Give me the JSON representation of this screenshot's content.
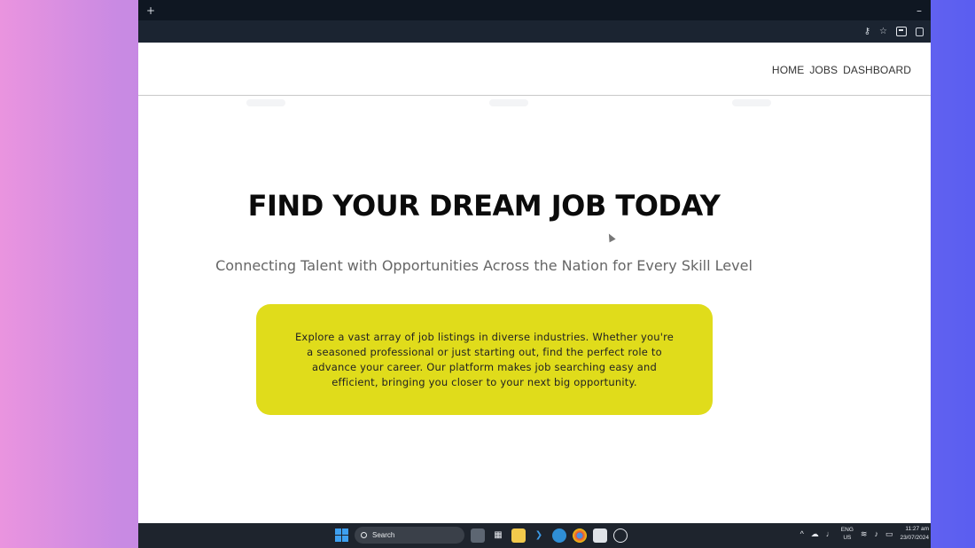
{
  "browser": {
    "new_tab_glyph": "+",
    "minimize_glyph": "–",
    "toolbar_icons": [
      "key-icon",
      "star-icon",
      "extension-icon",
      "puzzle-icon"
    ]
  },
  "nav": {
    "links": [
      "HOME",
      "JOBS",
      "DASHBOARD"
    ]
  },
  "hero": {
    "title": "FIND YOUR DREAM JOB TODAY",
    "subtitle": "Connecting Talent with Opportunities Across the Nation for Every Skill Level",
    "card_text": "Explore a vast array of job listings in diverse industries. Whether you're a seasoned professional or just starting out, find the perfect role to advance your career. Our platform makes job searching easy and efficient, bringing you closer to your next big opportunity.",
    "card_color": "#e0dc1b"
  },
  "taskbar": {
    "search_label": "Search",
    "language_top": "ENG",
    "language_bottom": "US",
    "time": "11:27 am",
    "date": "23/07/2024"
  },
  "colors": {
    "accent": "#e0dc1b",
    "chrome_dark": "#0f1722",
    "taskbar": "#1e242d"
  }
}
